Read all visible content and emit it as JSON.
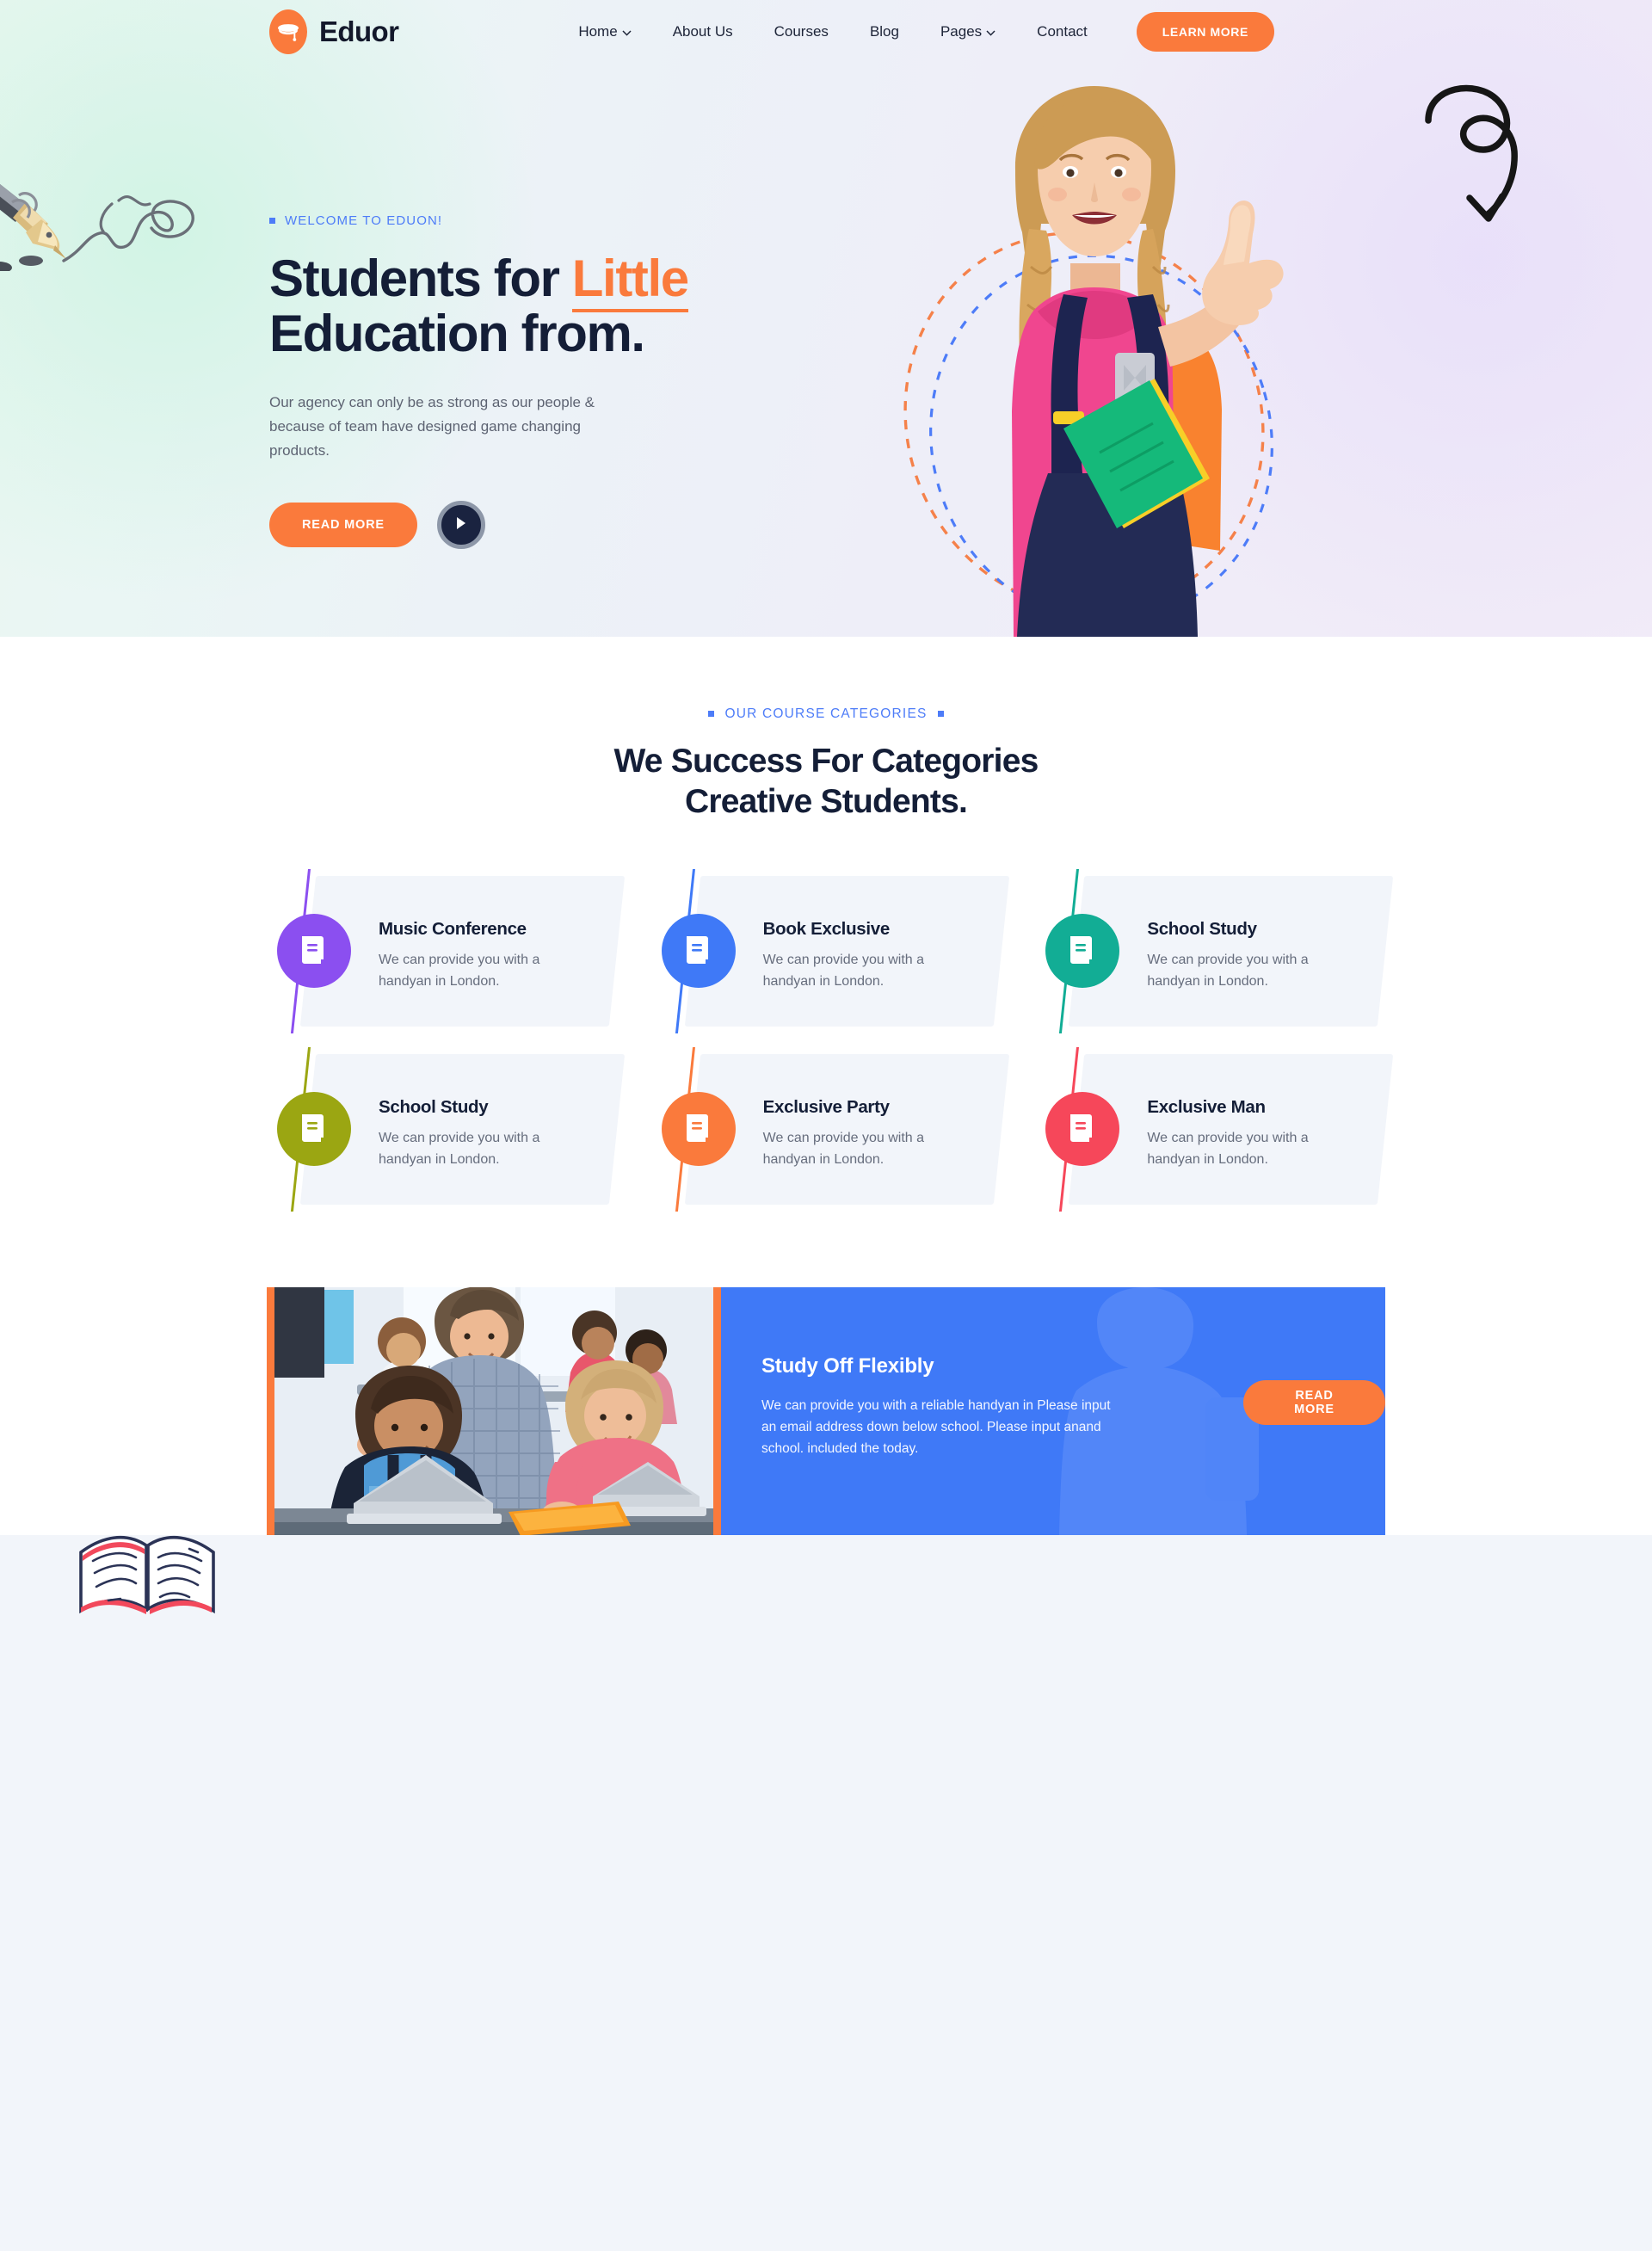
{
  "brand": {
    "name": "Eduor",
    "logo_icon": "graduation-cap-icon",
    "accent_orange": "#fa7a3c",
    "accent_blue": "#4d7cf8",
    "dark_navy": "#141e37"
  },
  "nav": {
    "items": [
      {
        "label": "Home",
        "has_dropdown": true
      },
      {
        "label": "About Us",
        "has_dropdown": false
      },
      {
        "label": "Courses",
        "has_dropdown": false
      },
      {
        "label": "Blog",
        "has_dropdown": false
      },
      {
        "label": "Pages",
        "has_dropdown": true
      },
      {
        "label": "Contact",
        "has_dropdown": false
      }
    ],
    "cta_label": "LEARN MORE"
  },
  "hero": {
    "eyebrow": "WELCOME TO EDUON!",
    "title_part1": "Students for ",
    "title_highlight": "Little",
    "title_part2": "Education from.",
    "subtitle": "Our agency can only be as strong as our people & because of team have designed game changing products.",
    "primary_button": "READ MORE",
    "play_button_icon": "play-icon",
    "decorations": [
      "fountain-pen-illustration",
      "curled-arrow-doodle",
      "dashed-oval-orange",
      "dashed-oval-blue"
    ],
    "photo_alt": "smiling schoolgirl with backpack giving thumbs up"
  },
  "categories_section": {
    "eyebrow": "OUR COURSE CATEGORIES",
    "title_line1": "We Success For Categories",
    "title_line2": "Creative Students.",
    "cards": [
      {
        "title": "Music Conference",
        "desc": "We can provide you with a handyan in London.",
        "color": "#8b4ff0",
        "icon": "book-icon"
      },
      {
        "title": "Book Exclusive",
        "desc": "We can provide you with a handyan in London.",
        "color": "#3f79f7",
        "icon": "book-icon"
      },
      {
        "title": "School Study",
        "desc": "We can provide you with a handyan in London.",
        "color": "#12ad95",
        "icon": "book-icon"
      },
      {
        "title": "School Study",
        "desc": "We can provide you with a handyan in London.",
        "color": "#9ba612",
        "icon": "book-icon"
      },
      {
        "title": "Exclusive Party",
        "desc": "We can provide you with a handyan in London.",
        "color": "#fa7a3c",
        "icon": "book-icon"
      },
      {
        "title": "Exclusive Man",
        "desc": "We can provide you with a handyan in London.",
        "color": "#f6475a",
        "icon": "book-icon"
      }
    ]
  },
  "promo": {
    "title": "Study Off Flexibly",
    "desc": "We can provide you with a reliable handyan in Please input an email address down below school. Please input anand school. included the today.",
    "button_label": "READ MORE",
    "background_color": "#3f79f7",
    "frame_color": "#fa7a3c",
    "photo_alt": "teacher helping students with laptops in a classroom"
  },
  "footer_decoration": {
    "icon": "open-book-illustration"
  }
}
